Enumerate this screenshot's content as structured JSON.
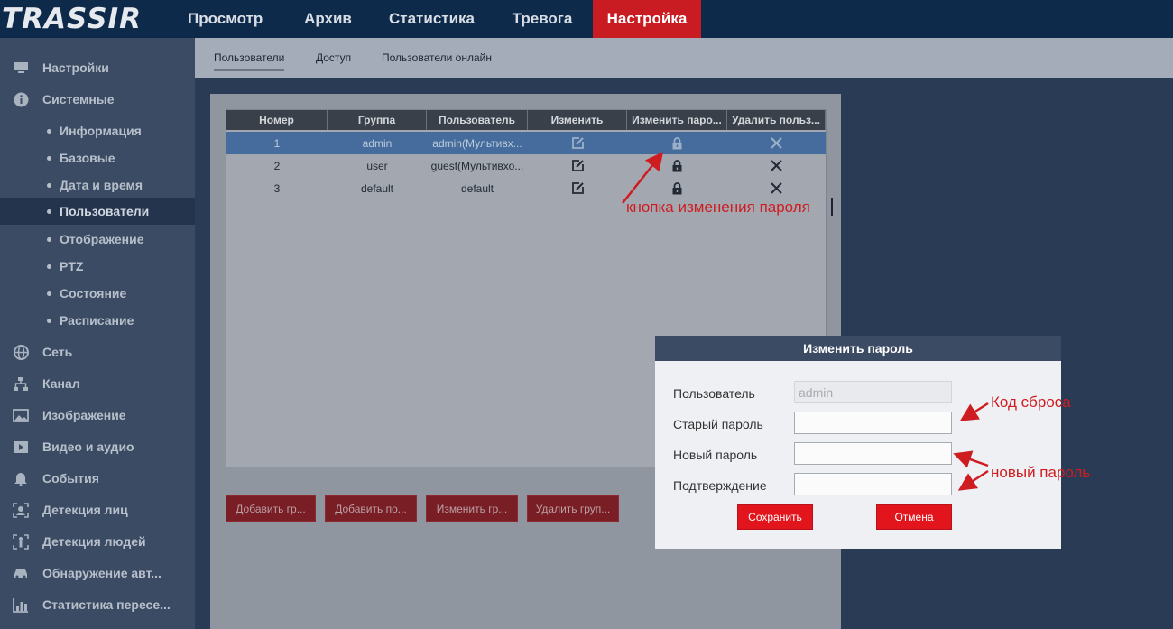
{
  "app": {
    "logo": "TRASSIR"
  },
  "top_nav": [
    "Просмотр",
    "Архив",
    "Статистика",
    "Тревога",
    "Настройка"
  ],
  "sidebar": {
    "items": [
      {
        "label": "Настройки",
        "icon": "monitor-icon"
      },
      {
        "label": "Системные",
        "icon": "info-icon"
      },
      {
        "label": "Информация",
        "sub": true
      },
      {
        "label": "Базовые",
        "sub": true
      },
      {
        "label": "Дата и время",
        "sub": true
      },
      {
        "label": "Пользователи",
        "sub": true,
        "active": true
      },
      {
        "label": "Отображение",
        "sub": true
      },
      {
        "label": "PTZ",
        "sub": true
      },
      {
        "label": "Состояние",
        "sub": true
      },
      {
        "label": "Расписание",
        "sub": true
      },
      {
        "label": "Сеть",
        "icon": "globe-icon"
      },
      {
        "label": "Канал",
        "icon": "network-icon"
      },
      {
        "label": "Изображение",
        "icon": "image-icon"
      },
      {
        "label": "Видео и аудио",
        "icon": "video-icon"
      },
      {
        "label": "События",
        "icon": "bell-icon"
      },
      {
        "label": "Детекция лиц",
        "icon": "face-detect-icon"
      },
      {
        "label": "Детекция людей",
        "icon": "person-detect-icon"
      },
      {
        "label": "Обнаружение авт...",
        "icon": "car-icon"
      },
      {
        "label": "Статистика пересе...",
        "icon": "bar-chart-icon"
      }
    ]
  },
  "sub_nav": [
    "Пользователи",
    "Доступ",
    "Пользователи онлайн"
  ],
  "users_table": {
    "headers": [
      "Номер",
      "Группа",
      "Пользователь",
      "Изменить",
      "Изменить паро...",
      "Удалить польз..."
    ],
    "rows": [
      {
        "num": "1",
        "group": "admin",
        "user": "admin(Мультивх...",
        "selected": true
      },
      {
        "num": "2",
        "group": "user",
        "user": "guest(Мультивхо..."
      },
      {
        "num": "3",
        "group": "default",
        "user": "default"
      }
    ]
  },
  "action_buttons": [
    "Добавить гр...",
    "Добавить по...",
    "Изменить гр...",
    "Удалить груп..."
  ],
  "dialog": {
    "title": "Изменить пароль",
    "fields": {
      "user_label": "Пользователь",
      "user_value": "admin",
      "old_label": "Старый пароль",
      "new_label": "Новый пароль",
      "confirm_label": "Подтверждение"
    },
    "save": "Сохранить",
    "cancel": "Отмена"
  },
  "annotations": {
    "lock_button": "кнопка изменения пароля",
    "reset_code": "Код сброса",
    "new_password": "новый пароль"
  },
  "colors": {
    "accent": "#c81b22",
    "topbar": "#0e2a4a",
    "annotation": "#cf1c20"
  }
}
